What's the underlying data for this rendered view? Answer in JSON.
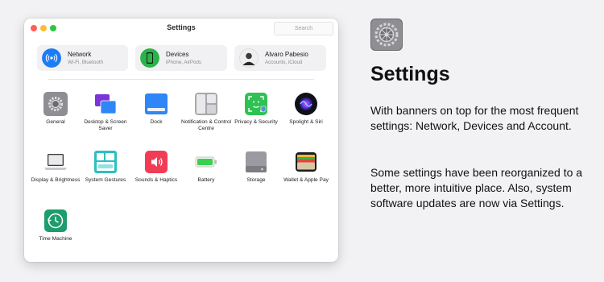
{
  "window": {
    "title": "Settings",
    "search_placeholder": "Search"
  },
  "banners": [
    {
      "title": "Network",
      "subtitle": "Wi-Fi, Bluetooth",
      "icon": "wifi-icon",
      "color": "#1c7cf4"
    },
    {
      "title": "Devices",
      "subtitle": "iPhone, AirPods",
      "icon": "phone-icon",
      "color": "#2bb34a"
    },
    {
      "title": "Alvaro Pabesio",
      "subtitle": "Accounts, iCloud",
      "icon": "avatar",
      "color": "#444444"
    }
  ],
  "grid": [
    {
      "label": "General",
      "icon": "gear-icon"
    },
    {
      "label": "Desktop & Screen Saver",
      "icon": "desktop-icon"
    },
    {
      "label": "Dock",
      "icon": "dock-icon"
    },
    {
      "label": "Notification & Control Centre",
      "icon": "notification-icon"
    },
    {
      "label": "Privacy & Security",
      "icon": "face-id-icon"
    },
    {
      "label": "Spolight & Siri",
      "icon": "siri-icon"
    },
    {
      "label": "Display & Brightness",
      "icon": "laptop-icon"
    },
    {
      "label": "System Gestures",
      "icon": "gestures-icon"
    },
    {
      "label": "Sounds & Haptics",
      "icon": "speaker-icon"
    },
    {
      "label": "Battery",
      "icon": "battery-icon"
    },
    {
      "label": "Storage",
      "icon": "storage-icon"
    },
    {
      "label": "Wallet & Apple Pay",
      "icon": "wallet-icon"
    },
    {
      "label": "Time Machine",
      "icon": "time-machine-icon"
    }
  ],
  "info": {
    "heading": "Settings",
    "paragraph_1": "With banners on top for the most frequent settings: Network, Devices and Account.",
    "paragraph_2": "Some settings have been reorganized to a better, more intuitive place. Also, system software updates are now via Settings."
  }
}
